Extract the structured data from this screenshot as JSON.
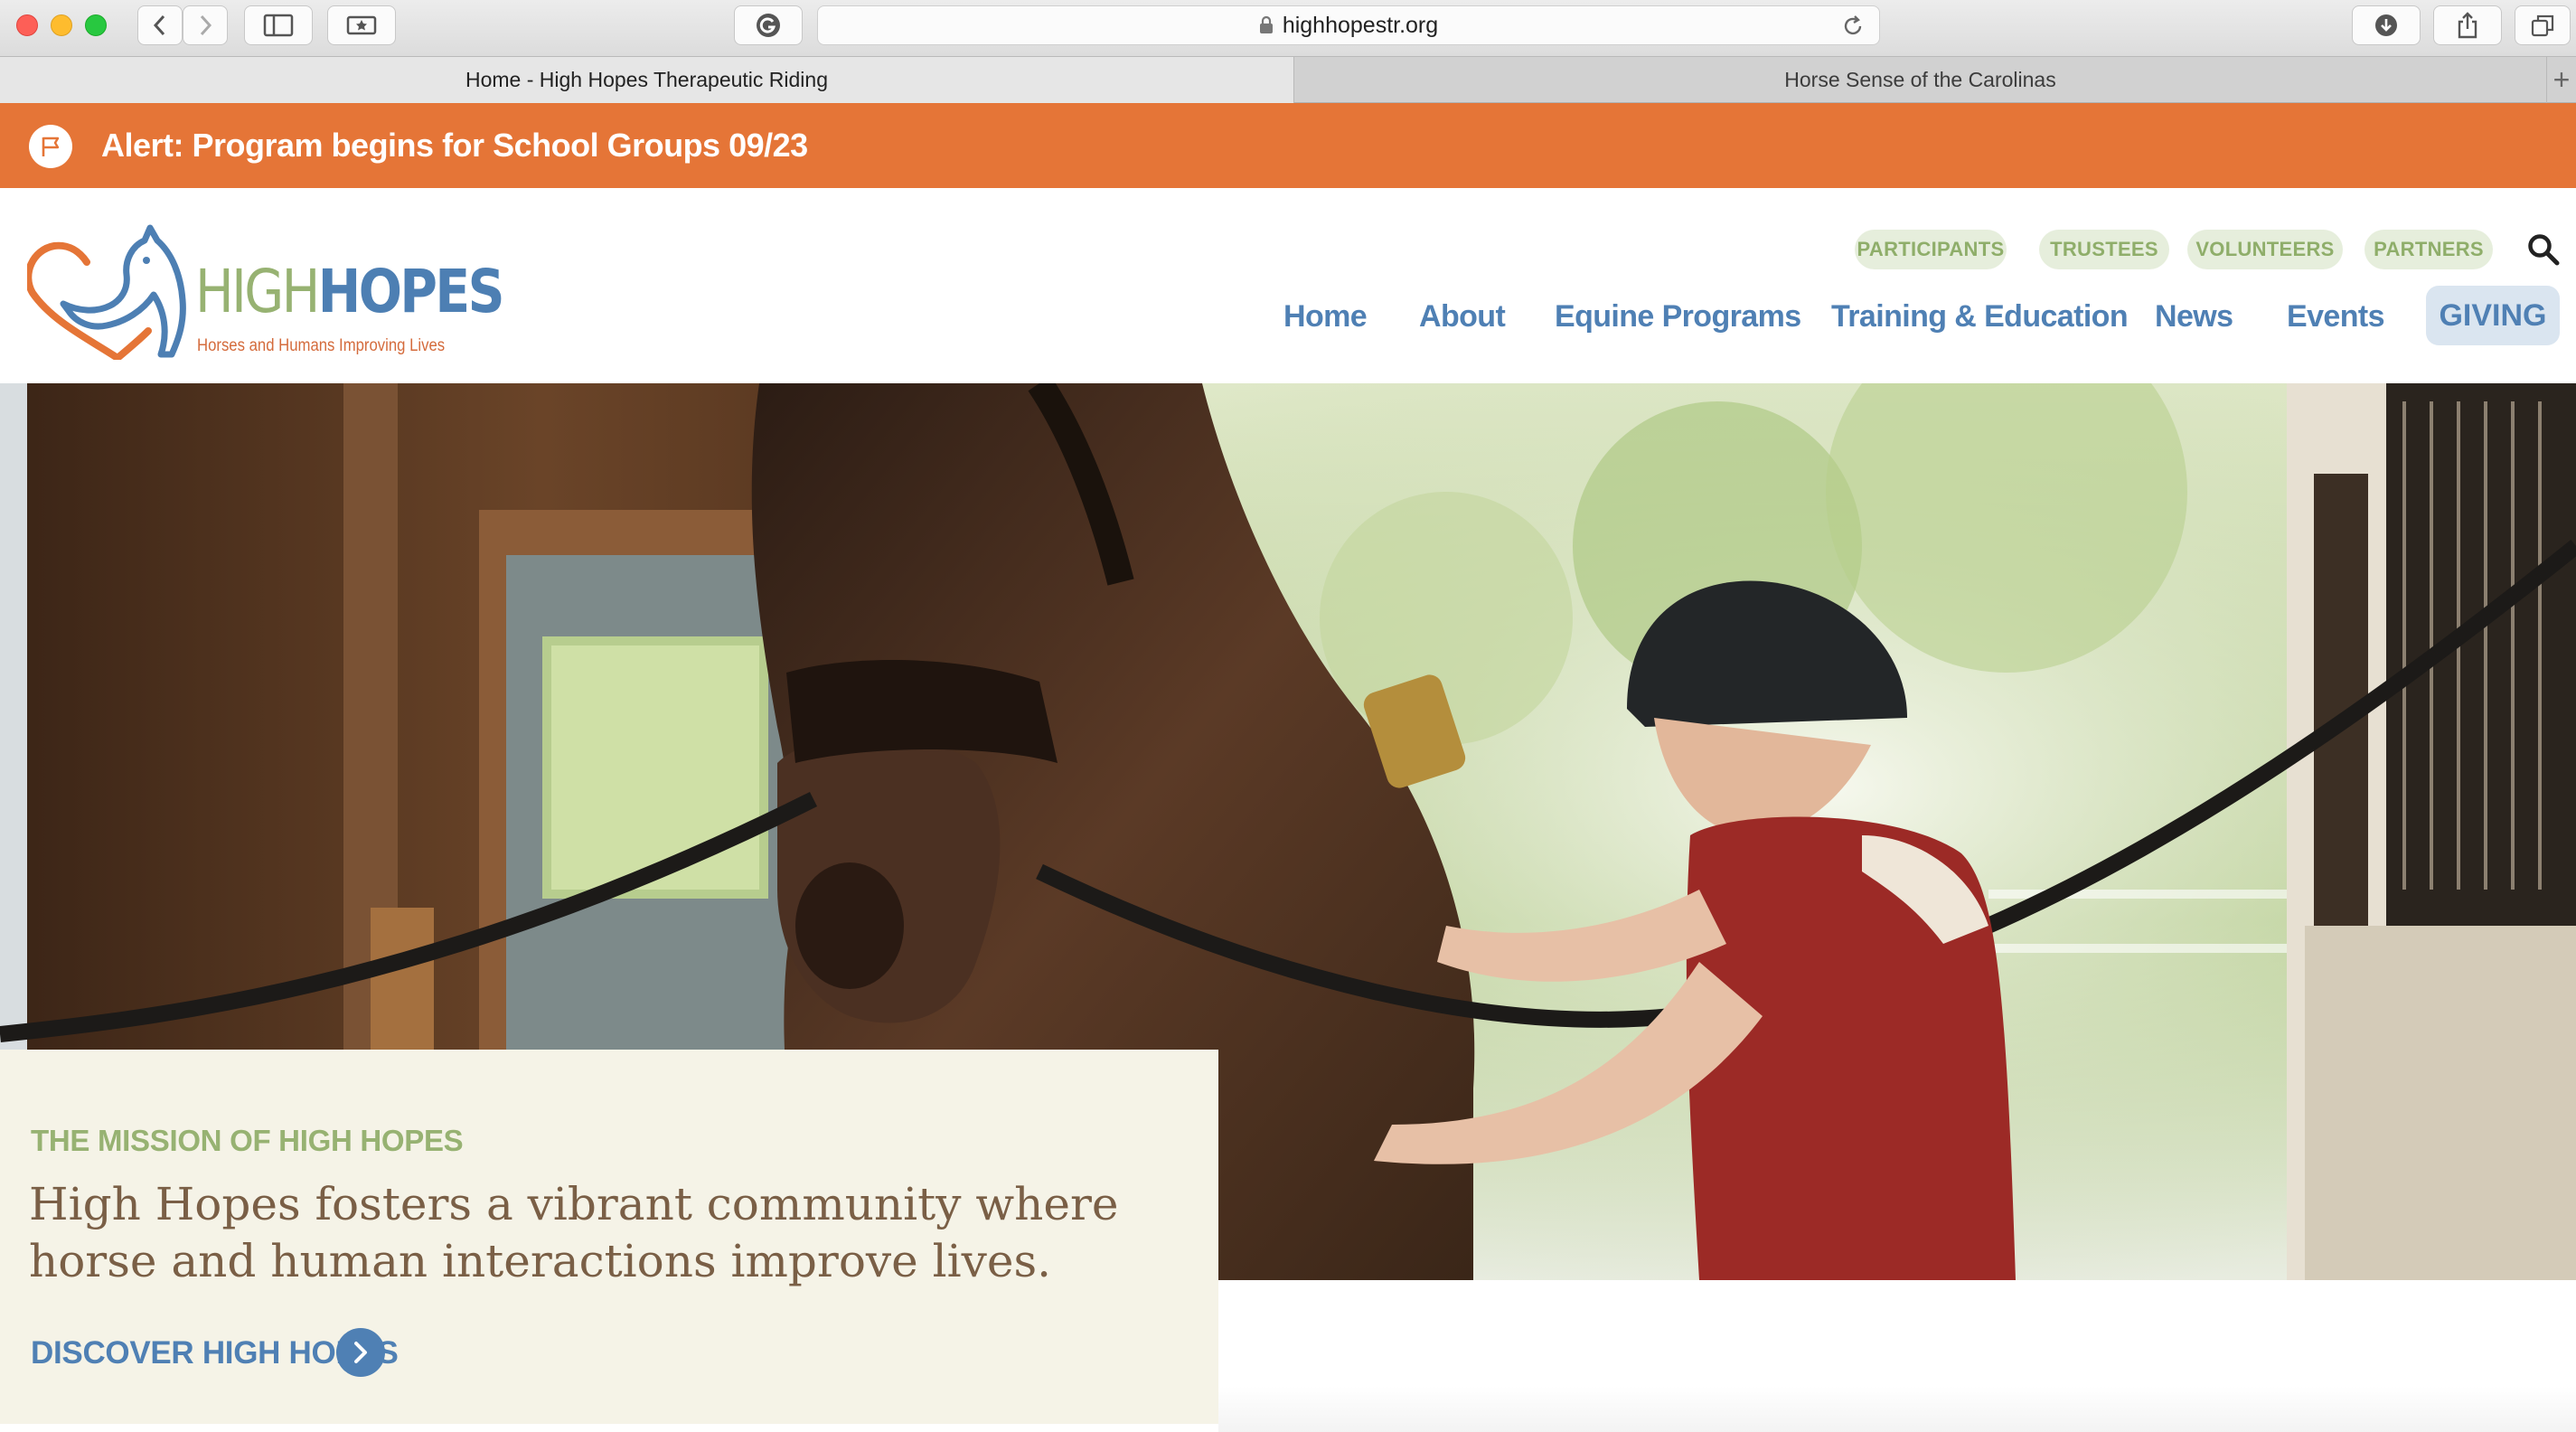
{
  "browser": {
    "url": "highhopestr.org",
    "tabs": [
      {
        "label": "Home - High Hopes Therapeutic Riding",
        "active": true
      },
      {
        "label": "Horse Sense of the Carolinas",
        "active": false
      }
    ],
    "toolbar_icons": [
      "back-icon",
      "forward-icon",
      "sidebar-icon",
      "bookmarks-icon",
      "grammarly-icon",
      "lock-icon",
      "reload-icon",
      "download-icon",
      "share-icon",
      "tabs-icon"
    ]
  },
  "alert": {
    "text": "Alert: Program begins for School Groups 09/23",
    "icon": "flag-icon",
    "color": "#e57537"
  },
  "logo": {
    "high": "HIGH",
    "hopes": "HOPES",
    "tagline": "Horses and Humans Improving Lives"
  },
  "utility_nav": [
    "PARTICIPANTS",
    "TRUSTEES",
    "VOLUNTEERS",
    "PARTNERS"
  ],
  "main_nav": {
    "items": [
      "Home",
      "About",
      "Equine Programs",
      "Training & Education",
      "News",
      "Events"
    ],
    "giving": "GIVING"
  },
  "mission": {
    "kicker": "THE MISSION OF HIGH HOPES",
    "statement": "High Hopes fosters a vibrant community where horse and human interactions improve lives.",
    "link": "DISCOVER HIGH HOPES"
  },
  "colors": {
    "accent_orange": "#e57537",
    "brand_blue": "#4f80b4",
    "brand_green": "#97b272",
    "mission_text": "#7a5f46",
    "mission_bg": "#f5f3e7"
  }
}
